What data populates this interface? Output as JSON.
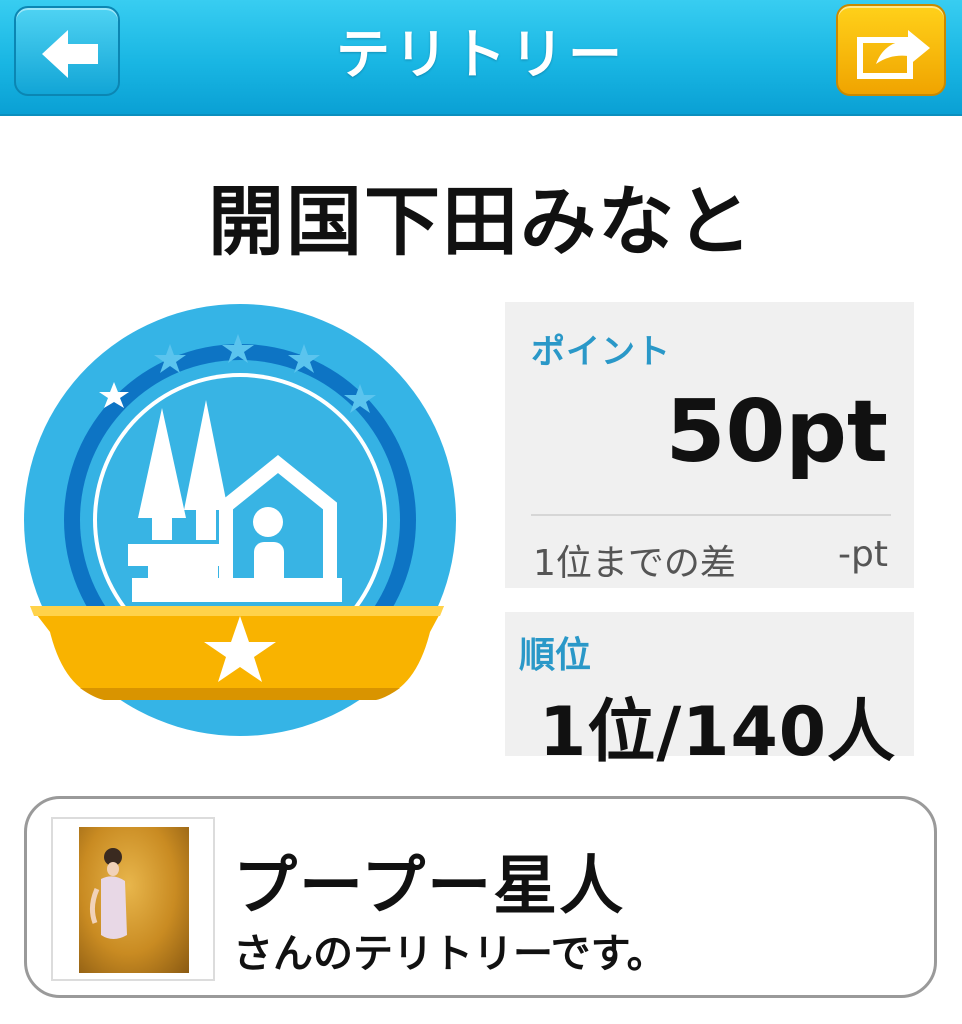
{
  "header": {
    "title": "テリトリー",
    "back_icon": "back-arrow-icon",
    "share_icon": "share-icon",
    "bar_color": "#19b6e3",
    "share_color": "#f5b400"
  },
  "territory": {
    "name": "開国下田みなと",
    "badge_icon": "tower-and-info-house-badge-icon"
  },
  "points": {
    "label": "ポイント",
    "value": "50pt",
    "gap_label": "1位までの差",
    "gap_value": "-pt"
  },
  "rank": {
    "label": "順位",
    "value": "1位/140人"
  },
  "owner": {
    "name": "プープー星人",
    "suffix": "さんのテリトリーです。"
  }
}
